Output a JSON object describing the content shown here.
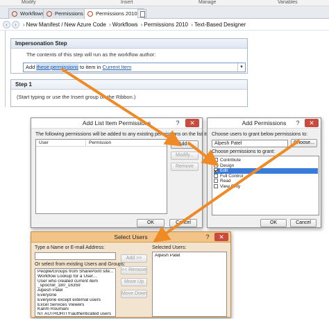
{
  "ribbon": {
    "groups": [
      "Modify",
      "Insert",
      "Manage",
      "Variables"
    ]
  },
  "tabs": [
    {
      "label": "Workflows"
    },
    {
      "label": "Permissions *"
    },
    {
      "label": "Permissions 2010 *"
    }
  ],
  "breadcrumb": [
    "New Manifest / New Azure Code",
    "Workflows",
    "Permissions 2010",
    "Text-Based Designer"
  ],
  "impersonation": {
    "title": "Impersonation Step",
    "description": "The contents of this step will run as the workflow author:",
    "action_prefix": "Add",
    "action_link1": "these permissions",
    "action_mid": "to item in",
    "action_link2": "Current Item"
  },
  "step1": {
    "title": "Step 1",
    "hint": "(Start typing or use the Insert group on the Ribbon.)"
  },
  "add_list_item_permissions": {
    "title": "Add List Item Permissions",
    "description": "The following permissions will be added to any existing permissions on the list item:",
    "columns": [
      "User",
      "Permission"
    ],
    "buttons": {
      "add": "Add...",
      "modify": "Modify...",
      "remove": "Remove",
      "ok": "OK",
      "cancel": "Cancel"
    }
  },
  "add_permissions": {
    "title": "Add Permissions",
    "users_label": "Choose users to grant below permissions to:",
    "users_value": "Alpesh Patel",
    "choose_button": "Choose...",
    "perms_label": "Choose permissions to grant:",
    "permissions": [
      {
        "label": "Contribute",
        "checked": false,
        "highlighted": false
      },
      {
        "label": "Design",
        "checked": false,
        "highlighted": false
      },
      {
        "label": "Edit",
        "checked": true,
        "highlighted": true
      },
      {
        "label": "Full Control",
        "checked": false,
        "highlighted": false
      },
      {
        "label": "Read",
        "checked": false,
        "highlighted": false
      },
      {
        "label": "View Only",
        "checked": false,
        "highlighted": false
      }
    ],
    "ok": "OK",
    "cancel": "Cancel"
  },
  "select_users": {
    "title": "Select Users",
    "type_label": "Type a Name or E-mail Address:",
    "or_label": "Or select from existing Users and Groups:",
    "selected_label": "Selected Users:",
    "users": [
      "People/Groups from SharePoint site...",
      "Workflow Lookup for a User...",
      "User who created current item",
      "_spocrwl_180_16359",
      "Alpesh Patel",
      "Everyone",
      "Everyone except external users",
      "Excel Services Viewers",
      "Karim Roumani",
      "NT AUTHORITY\\authenticated users"
    ],
    "selected_users": [
      "Alpesh Patel"
    ],
    "buttons": {
      "add": "Add >>",
      "remove": "<< Remove",
      "up": "Move Up",
      "down": "Move Down"
    }
  },
  "colors": {
    "arrow": "#f08a24",
    "accent": "#3a7ad8",
    "link": "#1b57a8"
  },
  "icons": [
    "workflow-tab-icon",
    "back-icon",
    "forward-icon",
    "dropdown-icon",
    "help-icon",
    "close-icon",
    "checkbox-icon",
    "arrow-annotation"
  ]
}
